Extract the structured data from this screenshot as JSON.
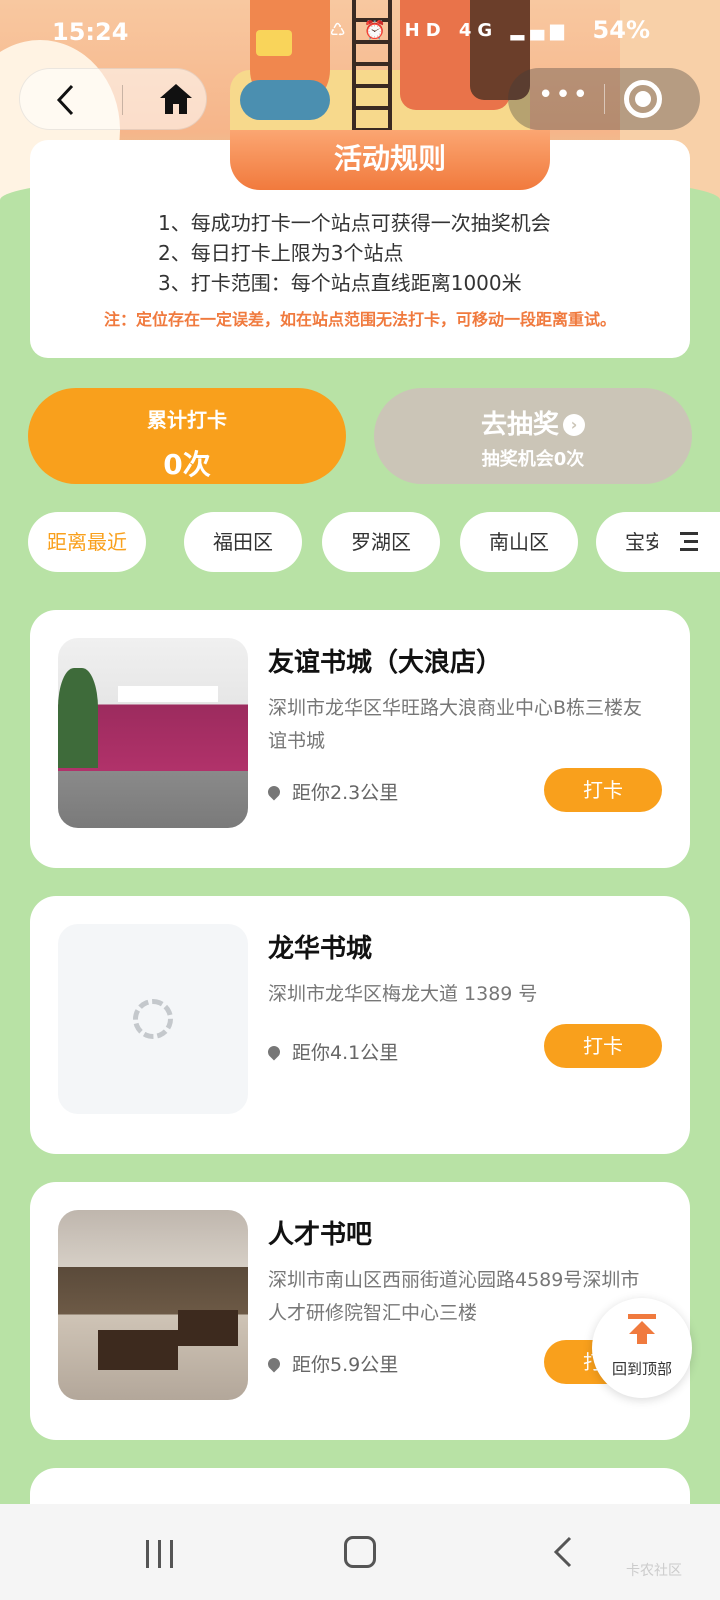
{
  "status": {
    "time": "15:24",
    "network": "HD 4G",
    "battery": "54%"
  },
  "rules": {
    "title": "活动规则",
    "lines": [
      "1、每成功打卡一个站点可获得一次抽奖机会",
      "2、每日打卡上限为3个站点",
      "3、打卡范围：每个站点直线距离1000米"
    ],
    "note": "注：定位存在一定误差，如在站点范围无法打卡，可移动一段距离重试。"
  },
  "stats": {
    "checkin_label": "累计打卡",
    "checkin_value": "0次",
    "draw_label": "去抽奖",
    "draw_chances": "抽奖机会0次"
  },
  "tabs": [
    "距离最近",
    "福田区",
    "罗湖区",
    "南山区",
    "宝安区"
  ],
  "stores": [
    {
      "name": "友谊书城（大浪店）",
      "address": "深圳市龙华区华旺路大浪商业中心B栋三楼友谊书城",
      "distance": "距你2.3公里",
      "action": "打卡"
    },
    {
      "name": "龙华书城",
      "address": "深圳市龙华区梅龙大道 1389 号",
      "distance": "距你4.1公里",
      "action": "打卡"
    },
    {
      "name": "人才书吧",
      "address": "深圳市南山区西丽街道沁园路4589号深圳市人才研修院智汇中心三楼",
      "distance": "距你5.9公里",
      "action": "打卡"
    }
  ],
  "back_to_top": "回到顶部",
  "watermark": "卡农社区",
  "colors": {
    "accent": "#f9a01c",
    "background": "#b8e2a5",
    "rules_header": "#f17a3d",
    "disabled": "#cbc5b7"
  }
}
